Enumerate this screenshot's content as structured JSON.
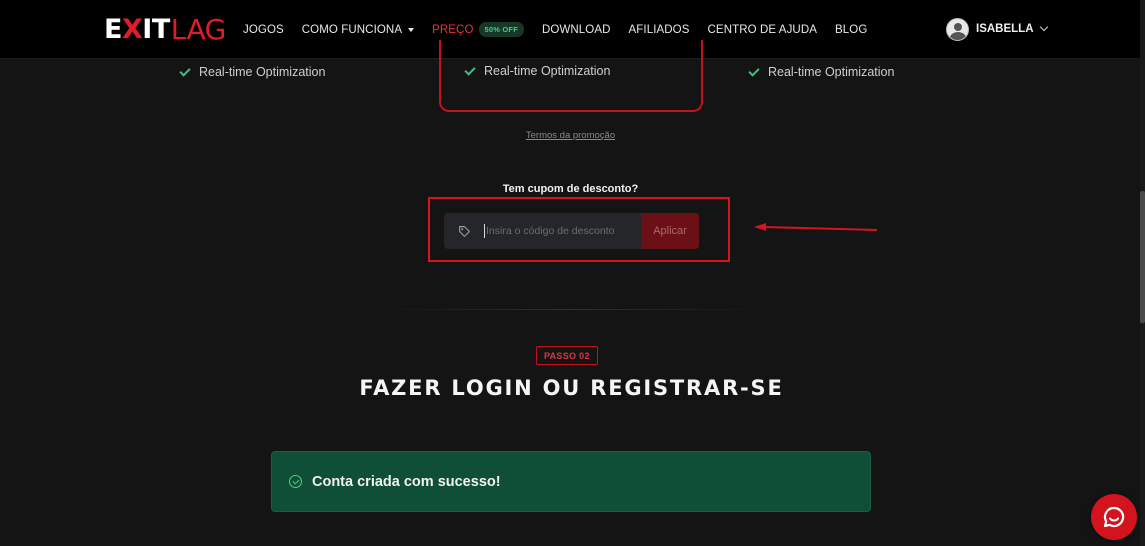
{
  "nav": {
    "logo_e": "E",
    "logo_x": "X",
    "logo_it": "IT",
    "logo_lag": "LAG",
    "items": [
      {
        "label": "JOGOS"
      },
      {
        "label": "COMO FUNCIONA"
      },
      {
        "label": "PREÇO",
        "badge": "50% OFF"
      },
      {
        "label": "DOWNLOAD"
      },
      {
        "label": "AFILIADOS"
      },
      {
        "label": "CENTRO DE AJUDA"
      },
      {
        "label": "BLOG"
      }
    ],
    "user_name": "ISABELLA"
  },
  "plans": {
    "feature_label": "Real-time Optimization",
    "promo_terms": "Termos da promoção"
  },
  "coupon": {
    "title": "Tem cupom de desconto?",
    "placeholder": "Insira o código de desconto",
    "value": "",
    "apply_label": "Aplicar"
  },
  "step2": {
    "badge": "PASSO 02",
    "title": "FAZER LOGIN OU REGISTRAR-SE"
  },
  "alert": {
    "message": "Conta criada com sucesso!",
    "color": "#0f4f37"
  },
  "colors": {
    "accent": "#d3131e",
    "success": "#4fd08b",
    "background": "#141414"
  }
}
